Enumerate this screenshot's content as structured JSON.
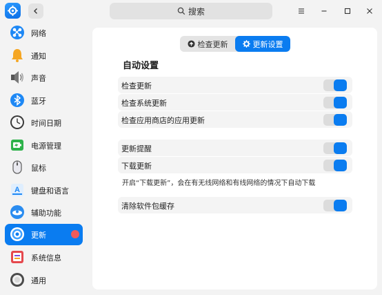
{
  "titlebar": {
    "search_placeholder": "搜索"
  },
  "sidebar": {
    "items": [
      {
        "label": "网络",
        "icon": "network-icon"
      },
      {
        "label": "通知",
        "icon": "bell-icon"
      },
      {
        "label": "声音",
        "icon": "speaker-icon"
      },
      {
        "label": "蓝牙",
        "icon": "bluetooth-icon"
      },
      {
        "label": "时间日期",
        "icon": "clock-icon"
      },
      {
        "label": "电源管理",
        "icon": "battery-icon"
      },
      {
        "label": "鼠标",
        "icon": "mouse-icon"
      },
      {
        "label": "键盘和语言",
        "icon": "keyboard-icon"
      },
      {
        "label": "辅助功能",
        "icon": "accessibility-icon"
      },
      {
        "label": "更新",
        "icon": "update-icon",
        "active": true,
        "badge": true
      },
      {
        "label": "系统信息",
        "icon": "system-info-icon"
      },
      {
        "label": "通用",
        "icon": "general-icon"
      }
    ]
  },
  "main": {
    "tabs": [
      {
        "label": "检查更新",
        "active": false
      },
      {
        "label": "更新设置",
        "active": true
      }
    ],
    "section_title": "自动设置",
    "settings": [
      {
        "label": "检查更新",
        "on": true
      },
      {
        "label": "检查系统更新",
        "on": true
      },
      {
        "label": "检查应用商店的应用更新",
        "on": true
      },
      {
        "label": "更新提醒",
        "on": true
      },
      {
        "label": "下载更新",
        "on": true
      },
      {
        "label": "清除软件包缓存",
        "on": true
      }
    ],
    "download_note": "开启“下载更新”，会在有无线网络和有线网络的情况下自动下载"
  },
  "colors": {
    "accent": "#0a7cf0",
    "badge": "#ef5b5b"
  }
}
